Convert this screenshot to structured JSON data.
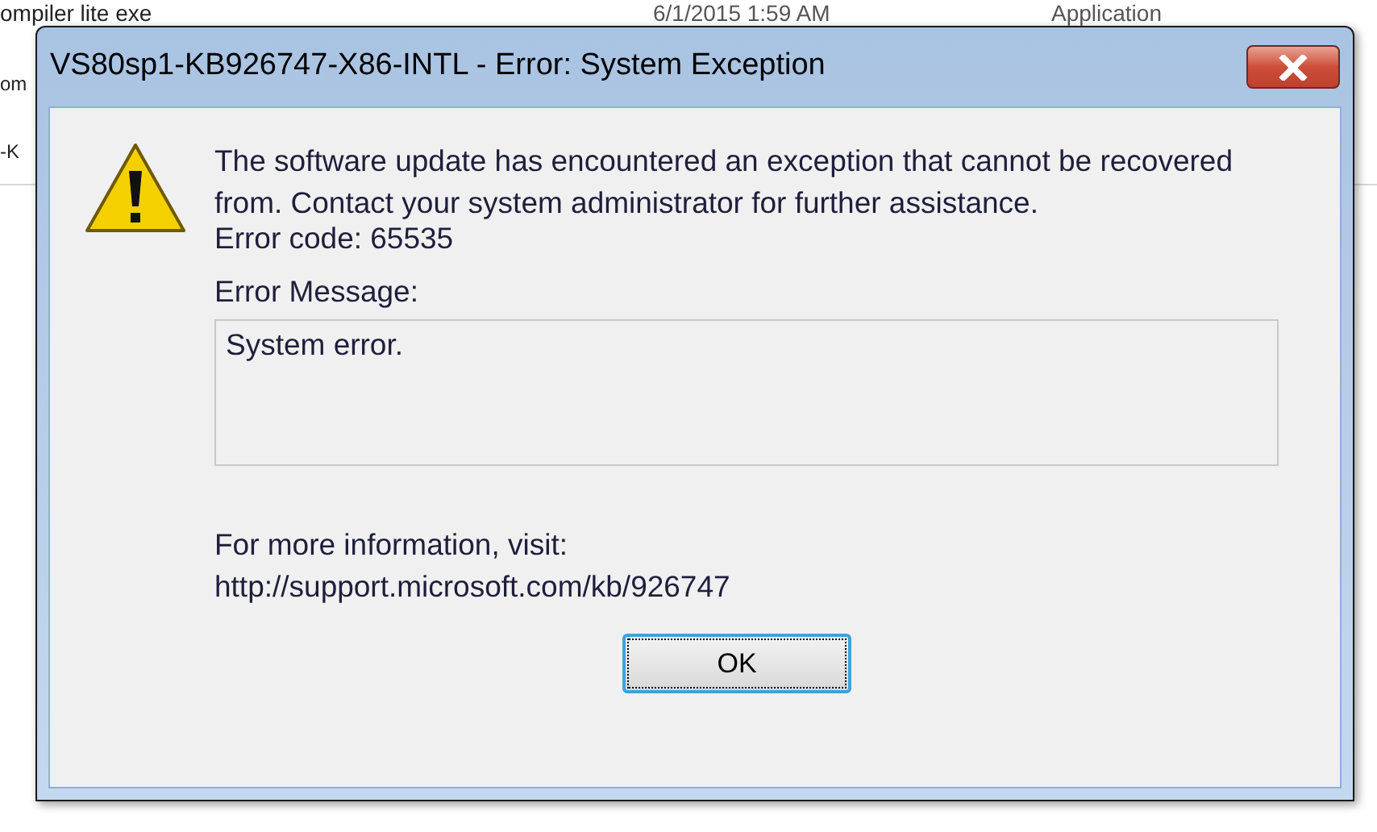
{
  "background_list": {
    "rows": [
      {
        "name": "ompiler lite exe",
        "date": "6/1/2015 1:59 AM",
        "type": "Application"
      },
      {
        "name": "om"
      },
      {
        "name": "-K"
      }
    ]
  },
  "dialog": {
    "title": "VS80sp1-KB926747-X86-INTL - Error: System Exception",
    "message": "The software update has encountered an exception that cannot be recovered from. Contact your system administrator for further assistance.",
    "error_code": "Error code: 65535",
    "error_message_label": "Error Message:",
    "error_message_value": "System error.",
    "info_label": "For more information, visit:",
    "info_link": "http://support.microsoft.com/kb/926747",
    "buttons": [
      {
        "label": "OK",
        "focused": true
      }
    ]
  }
}
